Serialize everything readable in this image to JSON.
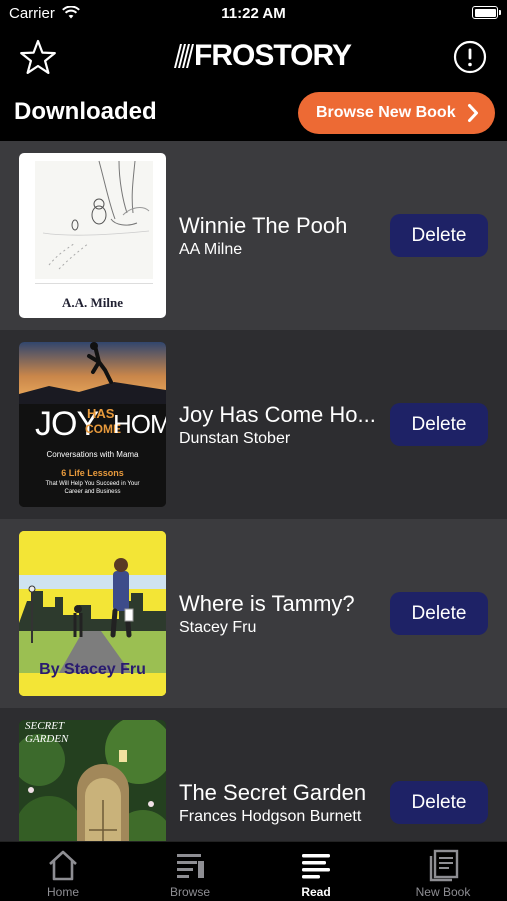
{
  "status_bar": {
    "carrier": "Carrier",
    "time": "11:22 AM"
  },
  "nav": {
    "logo_text": "FROSTORY",
    "logo_full": "AFROSTORY"
  },
  "header": {
    "title": "Downloaded",
    "browse_label": "Browse New Book"
  },
  "books": [
    {
      "title": "Winnie The Pooh",
      "author": "AA Milne",
      "delete_label": "Delete",
      "cover_text": "A.A. Milne"
    },
    {
      "title": "Joy Has Come Ho...",
      "author": "Dunstan Stober",
      "delete_label": "Delete",
      "cover_joy": "JOY",
      "cover_has": "HAS",
      "cover_come": "COME",
      "cover_home": "HOME",
      "cover_subtitle": "Conversations with Mama",
      "cover_lessons": "6 Life Lessons",
      "cover_tagline1": "That Will Help You Succeed in Your",
      "cover_tagline2": "Career and Business"
    },
    {
      "title": "Where is Tammy?",
      "author": "Stacey Fru",
      "delete_label": "Delete",
      "cover_byline": "By Stacey Fru"
    },
    {
      "title": "The Secret Garden",
      "author": "Frances Hodgson Burnett",
      "delete_label": "Delete",
      "cover_line1": "SECRET",
      "cover_line2": "GARDEN"
    }
  ],
  "tabs": [
    {
      "label": "Home",
      "icon": "home-icon",
      "active": false
    },
    {
      "label": "Browse",
      "icon": "browse-icon",
      "active": false
    },
    {
      "label": "Read",
      "icon": "read-icon",
      "active": true
    },
    {
      "label": "New Book",
      "icon": "new-book-icon",
      "active": false
    }
  ],
  "colors": {
    "accent": "#ed6a34",
    "delete_button": "#1e2266",
    "row_light": "#3b3b3e",
    "row_dark": "#2d2d30"
  }
}
